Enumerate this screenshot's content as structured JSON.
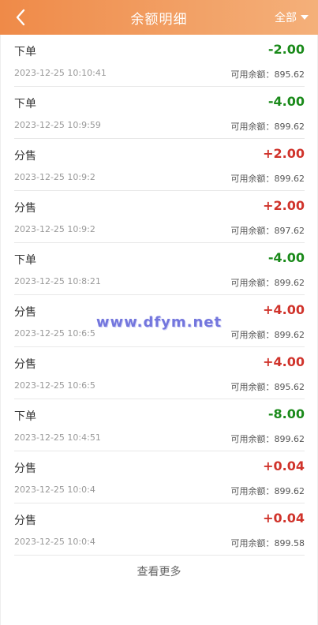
{
  "header": {
    "title": "余额明细",
    "filter_label": "全部",
    "gradient_start": "#ef8a48",
    "gradient_end": "#f4b07a"
  },
  "transactions": [
    {
      "type": "下单",
      "amount": "-2.00",
      "time": "2023-12-25 10:10:41",
      "balance_label": "可用余额：",
      "balance": "895.62",
      "sign": "neg"
    },
    {
      "type": "下单",
      "amount": "-4.00",
      "time": "2023-12-25 10:9:59",
      "balance_label": "可用余额：",
      "balance": "899.62",
      "sign": "neg"
    },
    {
      "type": "分售",
      "amount": "+2.00",
      "time": "2023-12-25 10:9:2",
      "balance_label": "可用余额：",
      "balance": "899.62",
      "sign": "pos"
    },
    {
      "type": "分售",
      "amount": "+2.00",
      "time": "2023-12-25 10:9:2",
      "balance_label": "可用余额：",
      "balance": "897.62",
      "sign": "pos"
    },
    {
      "type": "下单",
      "amount": "-4.00",
      "time": "2023-12-25 10:8:21",
      "balance_label": "可用余额：",
      "balance": "899.62",
      "sign": "neg"
    },
    {
      "type": "分售",
      "amount": "+4.00",
      "time": "2023-12-25 10:6:5",
      "balance_label": "可用余额：",
      "balance": "899.62",
      "sign": "pos"
    },
    {
      "type": "分售",
      "amount": "+4.00",
      "time": "2023-12-25 10:6:5",
      "balance_label": "可用余额：",
      "balance": "895.62",
      "sign": "pos"
    },
    {
      "type": "下单",
      "amount": "-8.00",
      "time": "2023-12-25 10:4:51",
      "balance_label": "可用余额：",
      "balance": "899.62",
      "sign": "neg"
    },
    {
      "type": "分售",
      "amount": "+0.04",
      "time": "2023-12-25 10:0:4",
      "balance_label": "可用余额：",
      "balance": "899.62",
      "sign": "pos"
    },
    {
      "type": "分售",
      "amount": "+0.04",
      "time": "2023-12-25 10:0:4",
      "balance_label": "可用余额：",
      "balance": "899.58",
      "sign": "pos"
    }
  ],
  "load_more_label": "查看更多",
  "watermark_text": "www.dfym.net",
  "colors": {
    "negative": "#1a8a1a",
    "positive": "#d0332b"
  },
  "icons": {
    "back": "chevron-left-icon",
    "filter": "caret-down-icon"
  }
}
